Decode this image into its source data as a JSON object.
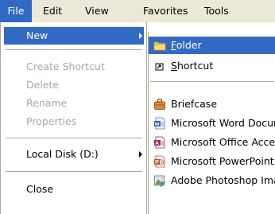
{
  "menubar": {
    "items": [
      {
        "label": "File",
        "active": true
      },
      {
        "label": "Edit"
      },
      {
        "label": "View"
      },
      {
        "label": "Favorites"
      },
      {
        "label": "Tools"
      }
    ]
  },
  "file_menu": {
    "new": "New",
    "create_shortcut": "Create Shortcut",
    "delete": "Delete",
    "rename": "Rename",
    "properties": "Properties",
    "local_disk": "Local Disk (D:)",
    "close": "Close"
  },
  "new_submenu": {
    "folder": {
      "accel": "F",
      "rest": "older"
    },
    "shortcut": {
      "accel": "S",
      "rest": "hortcut"
    },
    "briefcase": "Briefcase",
    "word": "Microsoft Word Document",
    "office": "Microsoft Office Access Application",
    "powerpoint": "Microsoft PowerPoint Presentation",
    "photoshop": "Adobe Photoshop Image"
  },
  "colors": {
    "highlight": "#316ac5",
    "menubar_bg": "#ece9d8",
    "disabled_text": "#aca899",
    "folder_yellow": "#f2c94c"
  }
}
